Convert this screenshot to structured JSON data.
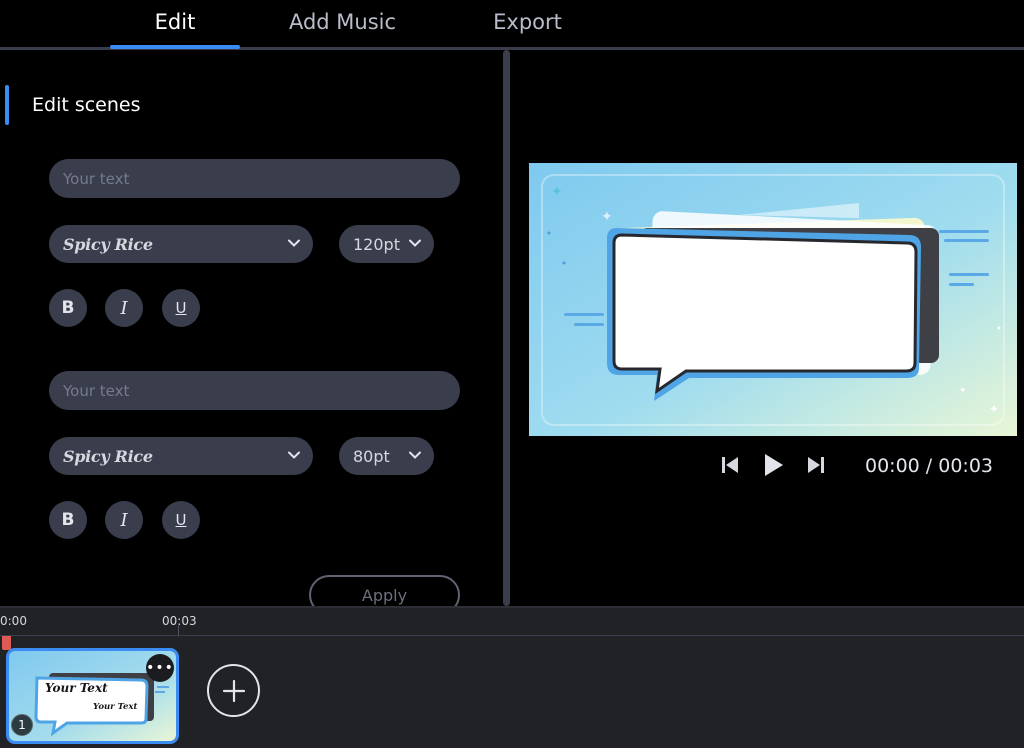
{
  "tabs": [
    {
      "label": "Edit",
      "active": true
    },
    {
      "label": "Add Music",
      "active": false
    },
    {
      "label": "Export",
      "active": false
    }
  ],
  "editor": {
    "section_title": "Edit scenes",
    "text_blocks": [
      {
        "text_value": "",
        "placeholder": "Your text",
        "font": "Spicy Rice",
        "size": "120pt",
        "format_buttons": [
          "B",
          "I",
          "U"
        ]
      },
      {
        "text_value": "",
        "placeholder": "Your text",
        "font": "Spicy Rice",
        "size": "80pt",
        "format_buttons": [
          "B",
          "I",
          "U"
        ]
      }
    ],
    "apply_label": "Apply"
  },
  "player": {
    "timecode": "00:00 / 00:03",
    "icons": [
      "skip-back-icon",
      "play-icon",
      "skip-forward-icon"
    ]
  },
  "timeline": {
    "ruler_labels": [
      "0:00",
      "00:03"
    ],
    "clip": {
      "number": "1",
      "menu_glyph": "•••",
      "text_line_1": "Your Text",
      "text_line_2": "Your Text"
    },
    "add_scene_icon": "plus-icon"
  },
  "colors": {
    "accent": "#3b8cf2",
    "panel": "#3a3d4c",
    "timeline_bg": "#212226",
    "playhead": "#e05a55"
  }
}
